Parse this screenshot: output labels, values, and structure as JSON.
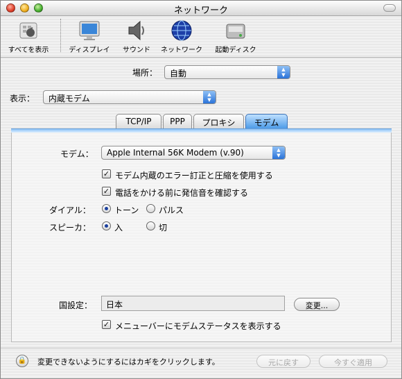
{
  "window": {
    "title": "ネットワーク"
  },
  "toolbar": {
    "items": [
      {
        "label": "すべてを表示",
        "icon": "show-all-icon"
      },
      {
        "label": "ディスプレイ",
        "icon": "display-icon"
      },
      {
        "label": "サウンド",
        "icon": "sound-icon"
      },
      {
        "label": "ネットワーク",
        "icon": "network-icon"
      },
      {
        "label": "起動ディスク",
        "icon": "startup-disk-icon"
      }
    ]
  },
  "location": {
    "label": "場所：",
    "value": "自動"
  },
  "show": {
    "label": "表示：",
    "value": "内蔵モデム"
  },
  "tabs": [
    {
      "label": "TCP/IP",
      "active": false
    },
    {
      "label": "PPP",
      "active": false
    },
    {
      "label": "プロキシ",
      "active": false
    },
    {
      "label": "モデム",
      "active": true
    }
  ],
  "modem": {
    "label": "モデム：",
    "value": "Apple Internal 56K Modem (v.90)",
    "error_correction": {
      "label": "モデム内蔵のエラー訂正と圧縮を使用する",
      "checked": true
    },
    "dial_tone": {
      "label": "電話をかける前に発信音を確認する",
      "checked": true
    },
    "dialing": {
      "label": "ダイアル：",
      "options": [
        "トーン",
        "パルス"
      ],
      "selected": "トーン"
    },
    "speaker": {
      "label": "スピーカ：",
      "options": [
        "入",
        "切"
      ],
      "selected": "入"
    },
    "country": {
      "label": "国設定：",
      "value": "日本",
      "change_button": "変更..."
    },
    "menubar_status": {
      "label": "メニューバーにモデムステータスを表示する",
      "checked": true
    }
  },
  "footer": {
    "lock_text": "変更できないようにするにはカギをクリックします。",
    "revert_button": "元に戻す",
    "apply_button": "今すぐ適用"
  },
  "colors": {
    "accent": "#2a73d9",
    "tab_active": "#4d9be8"
  }
}
